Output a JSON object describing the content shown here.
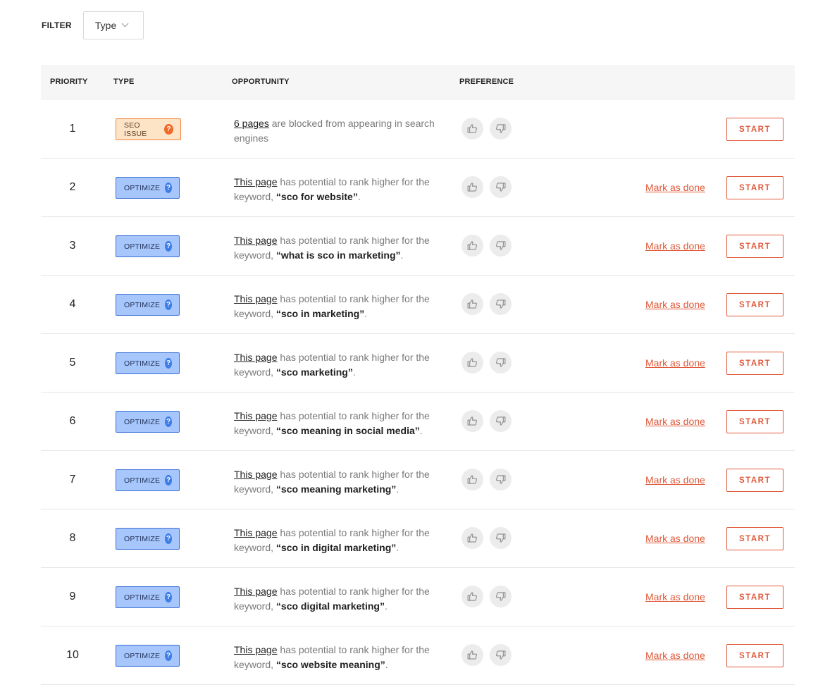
{
  "filter": {
    "label": "FILTER",
    "select_value": "Type"
  },
  "columns": {
    "priority": "PRIORITY",
    "type": "TYPE",
    "opportunity": "OPPORTUNITY",
    "preference": "PREFERENCE"
  },
  "colors": {
    "accent": "#e0593a",
    "seo_badge_bg": "#fde4c7",
    "optimize_badge_bg": "#a7c6fb"
  },
  "rows": [
    {
      "priority": "1",
      "type": "SEO ISSUE",
      "kind": "seo",
      "link": "6 pages",
      "text": " are blocked from appearing in search engines",
      "keyword": "",
      "mark_done": "",
      "start": "START"
    },
    {
      "priority": "2",
      "type": "OPTIMIZE",
      "kind": "opt",
      "link": "This page",
      "text": " has potential to rank higher for the keyword, ",
      "keyword": "“sco for website”",
      "mark_done": "Mark as done",
      "start": "START"
    },
    {
      "priority": "3",
      "type": "OPTIMIZE",
      "kind": "opt",
      "link": "This page",
      "text": " has potential to rank higher for the keyword, ",
      "keyword": "“what is sco in marketing”",
      "mark_done": "Mark as done",
      "start": "START"
    },
    {
      "priority": "4",
      "type": "OPTIMIZE",
      "kind": "opt",
      "link": "This page",
      "text": " has potential to rank higher for the keyword, ",
      "keyword": "“sco in marketing”",
      "mark_done": "Mark as done",
      "start": "START"
    },
    {
      "priority": "5",
      "type": "OPTIMIZE",
      "kind": "opt",
      "link": "This page",
      "text": " has potential to rank higher for the keyword, ",
      "keyword": "“sco marketing”",
      "mark_done": "Mark as done",
      "start": "START"
    },
    {
      "priority": "6",
      "type": "OPTIMIZE",
      "kind": "opt",
      "link": "This page",
      "text": " has potential to rank higher for the keyword, ",
      "keyword": "“sco meaning in social media”",
      "mark_done": "Mark as done",
      "start": "START"
    },
    {
      "priority": "7",
      "type": "OPTIMIZE",
      "kind": "opt",
      "link": "This page",
      "text": " has potential to rank higher for the keyword, ",
      "keyword": "“sco meaning marketing”",
      "mark_done": "Mark as done",
      "start": "START"
    },
    {
      "priority": "8",
      "type": "OPTIMIZE",
      "kind": "opt",
      "link": "This page",
      "text": " has potential to rank higher for the keyword, ",
      "keyword": "“sco in digital marketing”",
      "mark_done": "Mark as done",
      "start": "START"
    },
    {
      "priority": "9",
      "type": "OPTIMIZE",
      "kind": "opt",
      "link": "This page",
      "text": " has potential to rank higher for the keyword, ",
      "keyword": "“sco digital marketing”",
      "mark_done": "Mark as done",
      "start": "START"
    },
    {
      "priority": "10",
      "type": "OPTIMIZE",
      "kind": "opt",
      "link": "This page",
      "text": " has potential to rank higher for the keyword, ",
      "keyword": "“sco website meaning”",
      "mark_done": "Mark as done",
      "start": "START"
    }
  ]
}
